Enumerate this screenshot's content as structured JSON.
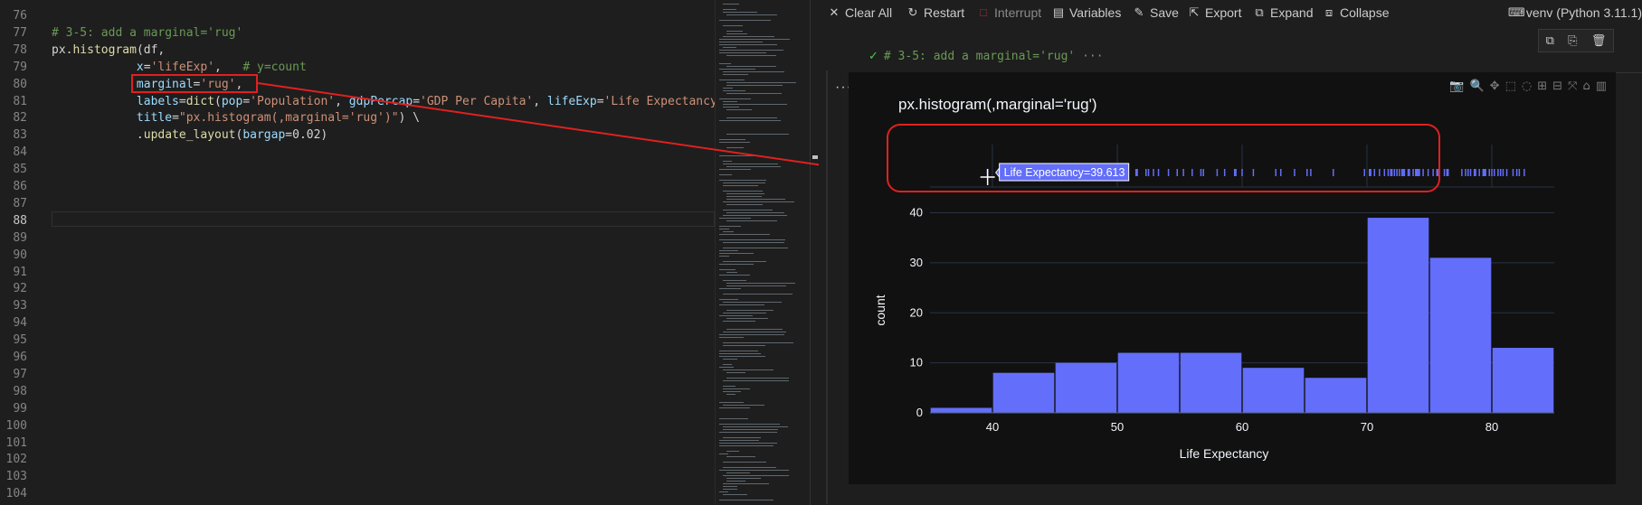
{
  "editor": {
    "lines": [
      {
        "no": "76",
        "tokens": []
      },
      {
        "no": "77",
        "tokens": [
          {
            "t": "c",
            "v": "# 3-5: add a marginal='rug'"
          }
        ]
      },
      {
        "no": "78",
        "tokens": [
          {
            "t": "p",
            "v": "px."
          },
          {
            "t": "f",
            "v": "histogram"
          },
          {
            "t": "p",
            "v": "(df,"
          }
        ]
      },
      {
        "no": "79",
        "tokens": [
          {
            "t": "p",
            "v": "            "
          },
          {
            "t": "v",
            "v": "x"
          },
          {
            "t": "p",
            "v": "="
          },
          {
            "t": "s",
            "v": "'lifeExp'"
          },
          {
            "t": "p",
            "v": ",   "
          },
          {
            "t": "c",
            "v": "# y=count"
          }
        ]
      },
      {
        "no": "80",
        "tokens": [
          {
            "t": "p",
            "v": "            "
          },
          {
            "t": "v",
            "v": "marginal"
          },
          {
            "t": "p",
            "v": "="
          },
          {
            "t": "s",
            "v": "'rug'"
          },
          {
            "t": "p",
            "v": ","
          }
        ]
      },
      {
        "no": "81",
        "tokens": [
          {
            "t": "p",
            "v": "            "
          },
          {
            "t": "v",
            "v": "labels"
          },
          {
            "t": "p",
            "v": "="
          },
          {
            "t": "f",
            "v": "dict"
          },
          {
            "t": "p",
            "v": "("
          },
          {
            "t": "v",
            "v": "pop"
          },
          {
            "t": "p",
            "v": "="
          },
          {
            "t": "s",
            "v": "'Population'"
          },
          {
            "t": "p",
            "v": ", "
          },
          {
            "t": "v",
            "v": "gdpPercap"
          },
          {
            "t": "p",
            "v": "="
          },
          {
            "t": "s",
            "v": "'GDP Per Capita'"
          },
          {
            "t": "p",
            "v": ", "
          },
          {
            "t": "v",
            "v": "lifeExp"
          },
          {
            "t": "p",
            "v": "="
          },
          {
            "t": "s",
            "v": "'Life Expectancy"
          }
        ]
      },
      {
        "no": "82",
        "tokens": [
          {
            "t": "p",
            "v": "            "
          },
          {
            "t": "v",
            "v": "title"
          },
          {
            "t": "p",
            "v": "="
          },
          {
            "t": "s",
            "v": "\"px.histogram(,marginal='rug')\""
          },
          {
            "t": "p",
            "v": ") \\"
          }
        ]
      },
      {
        "no": "83",
        "tokens": [
          {
            "t": "p",
            "v": "            ."
          },
          {
            "t": "f",
            "v": "update_layout"
          },
          {
            "t": "p",
            "v": "("
          },
          {
            "t": "v",
            "v": "bargap"
          },
          {
            "t": "p",
            "v": "=0.02)"
          }
        ]
      },
      {
        "no": "84",
        "tokens": []
      },
      {
        "no": "85",
        "tokens": []
      },
      {
        "no": "86",
        "tokens": []
      },
      {
        "no": "87",
        "tokens": []
      },
      {
        "no": "88",
        "tokens": [],
        "current": true
      },
      {
        "no": "89",
        "tokens": []
      },
      {
        "no": "90",
        "tokens": []
      },
      {
        "no": "91",
        "tokens": []
      },
      {
        "no": "92",
        "tokens": []
      },
      {
        "no": "93",
        "tokens": []
      },
      {
        "no": "94",
        "tokens": []
      },
      {
        "no": "95",
        "tokens": []
      },
      {
        "no": "96",
        "tokens": []
      },
      {
        "no": "97",
        "tokens": []
      },
      {
        "no": "98",
        "tokens": []
      },
      {
        "no": "99",
        "tokens": []
      },
      {
        "no": "100",
        "tokens": []
      },
      {
        "no": "101",
        "tokens": []
      },
      {
        "no": "102",
        "tokens": []
      },
      {
        "no": "103",
        "tokens": []
      },
      {
        "no": "104",
        "tokens": []
      }
    ]
  },
  "toolbar": {
    "items": [
      {
        "name": "clear-all-button",
        "icon": "close-icon",
        "glyph": "✕",
        "label": "Clear All",
        "disabled": false
      },
      {
        "name": "restart-button",
        "icon": "restart-icon",
        "glyph": "↻",
        "label": "Restart",
        "disabled": false
      },
      {
        "name": "interrupt-button",
        "icon": "stop-icon",
        "glyph": "□",
        "label": "Interrupt",
        "disabled": true
      },
      {
        "name": "variables-button",
        "icon": "variables-icon",
        "glyph": "▤",
        "label": "Variables",
        "disabled": false
      },
      {
        "name": "save-button",
        "icon": "save-icon",
        "glyph": "✎",
        "label": "Save",
        "disabled": false
      },
      {
        "name": "export-button",
        "icon": "export-icon",
        "glyph": "⇱",
        "label": "Export",
        "disabled": false
      },
      {
        "name": "expand-button",
        "icon": "expand-icon",
        "glyph": "⧉",
        "label": "Expand",
        "disabled": false
      },
      {
        "name": "collapse-button",
        "icon": "collapse-icon",
        "glyph": "⧈",
        "label": "Collapse",
        "disabled": false
      }
    ],
    "kernel_label": "venv (Python 3.11.1)"
  },
  "cell": {
    "header_code": "# 3-5: add a marginal='rug'",
    "ellipsis": "···",
    "more": "···"
  },
  "colors": {
    "bar": "#636efa",
    "figure_bg": "#111111",
    "grid": "#283442",
    "annotation": "#e02020"
  },
  "tooltip": {
    "text": "Life Expectancy=39.613",
    "value": 39.613
  },
  "chart_data": {
    "type": "bar",
    "title": "px.histogram(,marginal='rug')",
    "xlabel": "Life Expectancy",
    "ylabel": "count",
    "xlim": [
      35,
      85
    ],
    "ylim": [
      0,
      41
    ],
    "x_ticks": [
      40,
      50,
      60,
      70,
      80
    ],
    "y_ticks": [
      0,
      10,
      20,
      30,
      40
    ],
    "bins": [
      {
        "x0": 35,
        "x1": 40,
        "count": 1
      },
      {
        "x0": 40,
        "x1": 45,
        "count": 8
      },
      {
        "x0": 45,
        "x1": 50,
        "count": 10
      },
      {
        "x0": 50,
        "x1": 55,
        "count": 12
      },
      {
        "x0": 55,
        "x1": 60,
        "count": 12
      },
      {
        "x0": 60,
        "x1": 65,
        "count": 9
      },
      {
        "x0": 65,
        "x1": 70,
        "count": 7
      },
      {
        "x0": 70,
        "x1": 75,
        "count": 39
      },
      {
        "x0": 75,
        "x1": 80,
        "count": 31
      },
      {
        "x0": 80,
        "x1": 85,
        "count": 13
      }
    ],
    "rug_values": [
      39.6,
      43.1,
      43.8,
      44.5,
      45.0,
      45.2,
      46.2,
      46.4,
      46.5,
      47.5,
      48.2,
      48.3,
      49.3,
      49.6,
      50.4,
      50.7,
      51.5,
      51.6,
      52.3,
      52.5,
      52.9,
      53.3,
      54.1,
      54.8,
      55.3,
      56.0,
      56.7,
      56.9,
      58.0,
      58.6,
      59.4,
      59.5,
      60.0,
      60.9,
      62.7,
      63.1,
      64.2,
      65.2,
      65.5,
      67.3,
      69.8,
      70.2,
      70.3,
      70.6,
      71.0,
      71.4,
      71.7,
      71.9,
      72.0,
      72.2,
      72.4,
      72.6,
      72.8,
      72.9,
      73.0,
      73.3,
      73.4,
      73.7,
      73.9,
      74.0,
      74.1,
      74.2,
      74.5,
      74.9,
      75.3,
      75.6,
      75.7,
      76.2,
      76.4,
      76.5,
      77.6,
      77.9,
      78.1,
      78.3,
      78.6,
      78.7,
      79.0,
      79.3,
      79.4,
      79.5,
      79.8,
      80.0,
      80.2,
      80.5,
      80.7,
      80.9,
      81.2,
      81.7,
      82.0,
      82.2,
      82.6
    ]
  }
}
